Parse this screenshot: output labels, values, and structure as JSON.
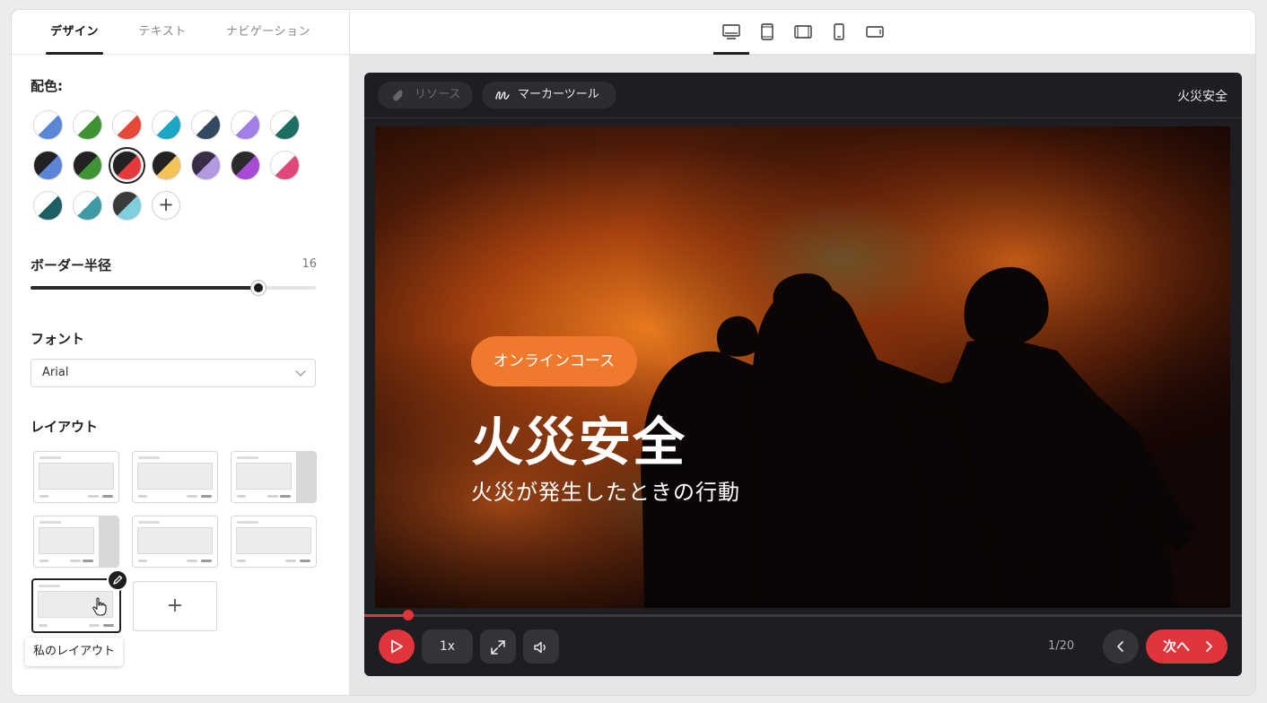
{
  "sidebar": {
    "tabs": [
      {
        "label": "デザイン",
        "active": true
      },
      {
        "label": "テキスト",
        "active": false
      },
      {
        "label": "ナビゲーション",
        "active": false
      }
    ],
    "color_scheme": {
      "label": "配色:",
      "swatches": [
        {
          "a": "#ffffff",
          "b": "#5b86d8"
        },
        {
          "a": "#ffffff",
          "b": "#3e9434"
        },
        {
          "a": "#ffffff",
          "b": "#e5493a"
        },
        {
          "a": "#ffffff",
          "b": "#1aa6c4"
        },
        {
          "a": "#ffffff",
          "b": "#33495e"
        },
        {
          "a": "#ffffff",
          "b": "#a27fe6"
        },
        {
          "a": "#ffffff",
          "b": "#1e6f63"
        },
        {
          "a": "#222222",
          "b": "#5b86d8"
        },
        {
          "a": "#222222",
          "b": "#3e9434"
        },
        {
          "a": "#222222",
          "b": "#e5383b",
          "selected": true
        },
        {
          "a": "#222222",
          "b": "#f3c258"
        },
        {
          "a": "#3a2d48",
          "b": "#b39ae0"
        },
        {
          "a": "#2b2b2b",
          "b": "#a84ad6"
        },
        {
          "a": "#ffffff",
          "b": "#e0487a"
        },
        {
          "a": "#ffffff",
          "b": "#1e5f66"
        },
        {
          "a": "#ffffff",
          "b": "#3f9aa8"
        },
        {
          "a": "#3a3a3a",
          "b": "#7fcfdf"
        }
      ],
      "add_label": "+"
    },
    "border_radius": {
      "label": "ボーダー半径",
      "value": "16",
      "fraction": 0.8
    },
    "font": {
      "label": "フォント",
      "value": "Arial"
    },
    "layout": {
      "label": "レイアウト",
      "tooltip": "私のレイアウト",
      "add_label": "+"
    }
  },
  "player": {
    "resources_label": "リソース",
    "marker_label": "マーカーツール",
    "course_title": "火災安全",
    "slide": {
      "badge": "オンラインコース",
      "title": "火災安全",
      "subtitle": "火災が発生したときの行動"
    },
    "progress_fraction": 0.05,
    "speed_label": "1x",
    "page_indicator": "1/20",
    "next_label": "次へ"
  },
  "colors": {
    "accent": "#e0353a",
    "badge": "#ef7a2e"
  }
}
